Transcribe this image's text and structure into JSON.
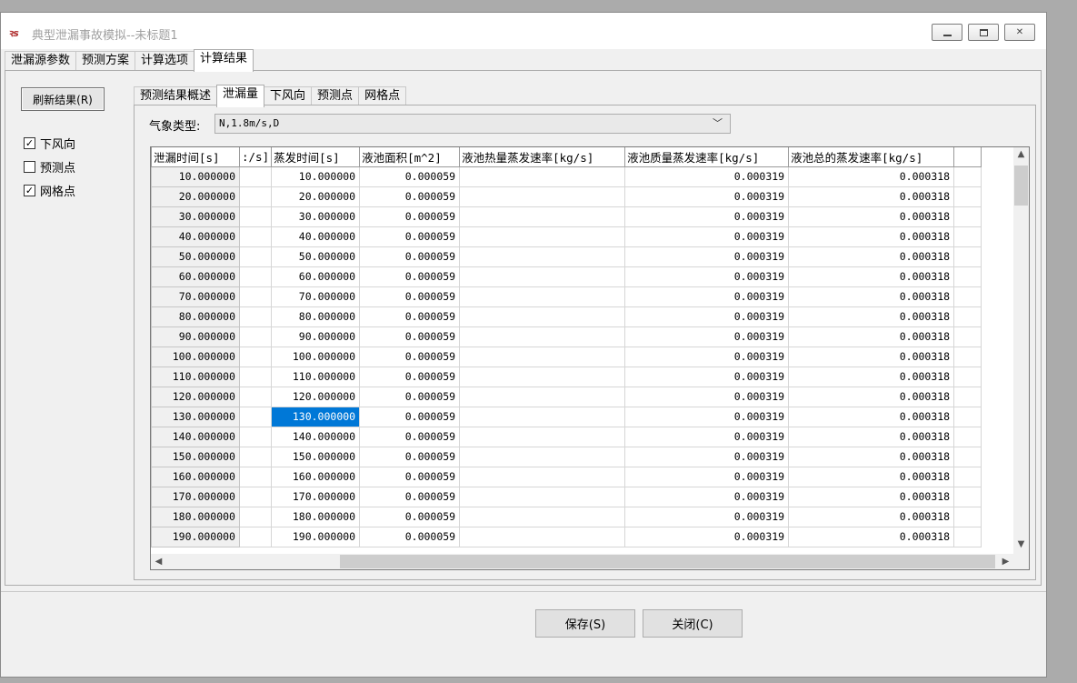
{
  "window": {
    "title": "典型泄漏事故模拟--未标题1",
    "icon": "app-logo-icon",
    "minimize_icon": "minimize-icon",
    "maximize_icon": "maximize-icon",
    "close_icon": "close-icon"
  },
  "main_tabs": [
    {
      "label": "泄漏源参数",
      "active": false
    },
    {
      "label": "预测方案",
      "active": false
    },
    {
      "label": "计算选项",
      "active": false
    },
    {
      "label": "计算结果",
      "active": true
    }
  ],
  "left": {
    "refresh_label": "刷新结果(R)",
    "checkboxes": [
      {
        "label": "下风向",
        "checked": true
      },
      {
        "label": "预测点",
        "checked": false
      },
      {
        "label": "网格点",
        "checked": true
      }
    ]
  },
  "inner_tabs": [
    {
      "label": "预测结果概述",
      "active": false
    },
    {
      "label": "泄漏量",
      "active": true
    },
    {
      "label": "下风向",
      "active": false
    },
    {
      "label": "预测点",
      "active": false
    },
    {
      "label": "网格点",
      "active": false
    }
  ],
  "weather": {
    "label": "气象类型:",
    "value": "N,1.8m/s,D"
  },
  "grid": {
    "columns": [
      "泄漏时间[s]",
      ":/s]",
      "蒸发时间[s]",
      "液池面积[m^2]",
      "液池热量蒸发速率[kg/s]",
      "液池质量蒸发速率[kg/s]",
      "液池总的蒸发速率[kg/s]",
      ""
    ],
    "rows": [
      [
        "10.000000",
        "",
        "10.000000",
        "0.000059",
        "",
        "0.000319",
        "0.000318",
        ""
      ],
      [
        "20.000000",
        "",
        "20.000000",
        "0.000059",
        "",
        "0.000319",
        "0.000318",
        ""
      ],
      [
        "30.000000",
        "",
        "30.000000",
        "0.000059",
        "",
        "0.000319",
        "0.000318",
        ""
      ],
      [
        "40.000000",
        "",
        "40.000000",
        "0.000059",
        "",
        "0.000319",
        "0.000318",
        ""
      ],
      [
        "50.000000",
        "",
        "50.000000",
        "0.000059",
        "",
        "0.000319",
        "0.000318",
        ""
      ],
      [
        "60.000000",
        "",
        "60.000000",
        "0.000059",
        "",
        "0.000319",
        "0.000318",
        ""
      ],
      [
        "70.000000",
        "",
        "70.000000",
        "0.000059",
        "",
        "0.000319",
        "0.000318",
        ""
      ],
      [
        "80.000000",
        "",
        "80.000000",
        "0.000059",
        "",
        "0.000319",
        "0.000318",
        ""
      ],
      [
        "90.000000",
        "",
        "90.000000",
        "0.000059",
        "",
        "0.000319",
        "0.000318",
        ""
      ],
      [
        "100.000000",
        "",
        "100.000000",
        "0.000059",
        "",
        "0.000319",
        "0.000318",
        ""
      ],
      [
        "110.000000",
        "",
        "110.000000",
        "0.000059",
        "",
        "0.000319",
        "0.000318",
        ""
      ],
      [
        "120.000000",
        "",
        "120.000000",
        "0.000059",
        "",
        "0.000319",
        "0.000318",
        ""
      ],
      [
        "130.000000",
        "",
        "130.000000",
        "0.000059",
        "",
        "0.000319",
        "0.000318",
        ""
      ],
      [
        "140.000000",
        "",
        "140.000000",
        "0.000059",
        "",
        "0.000319",
        "0.000318",
        ""
      ],
      [
        "150.000000",
        "",
        "150.000000",
        "0.000059",
        "",
        "0.000319",
        "0.000318",
        ""
      ],
      [
        "160.000000",
        "",
        "160.000000",
        "0.000059",
        "",
        "0.000319",
        "0.000318",
        ""
      ],
      [
        "170.000000",
        "",
        "170.000000",
        "0.000059",
        "",
        "0.000319",
        "0.000318",
        ""
      ],
      [
        "180.000000",
        "",
        "180.000000",
        "0.000059",
        "",
        "0.000319",
        "0.000318",
        ""
      ],
      [
        "190.000000",
        "",
        "190.000000",
        "0.000059",
        "",
        "0.000319",
        "0.000318",
        ""
      ]
    ],
    "selected_cell": {
      "row": 12,
      "col": 2
    },
    "selection_color": "#0078d7"
  },
  "buttons": {
    "save_label": "保存(S)",
    "close_label": "关闭(C)"
  }
}
